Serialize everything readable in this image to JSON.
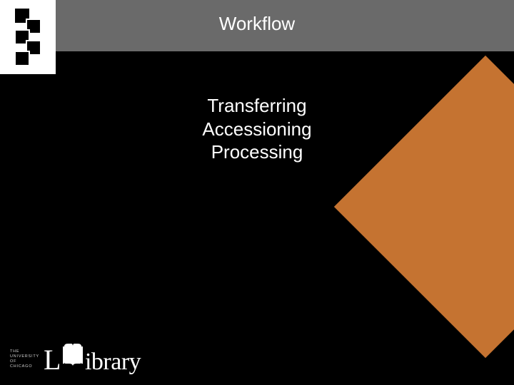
{
  "header": {
    "title": "Workflow"
  },
  "body": {
    "lines": [
      "Transferring",
      "Accessioning",
      "Processing"
    ]
  },
  "footer": {
    "institution_lines": [
      "THE",
      "UNIVERSITY",
      "OF",
      "CHICAGO"
    ],
    "wordmark_prefix": "L",
    "wordmark_suffix": "ibrary"
  },
  "colors": {
    "accent": "#c57331",
    "header_bar": "#6a6a6a",
    "background": "#000000"
  }
}
